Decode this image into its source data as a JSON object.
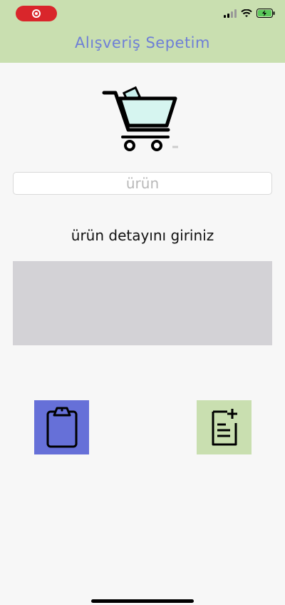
{
  "app": {
    "title": "Alışveriş Sepetim"
  },
  "status_bar": {
    "record_indicator": "record-icon",
    "icons": [
      "signal-icon",
      "wifi-icon",
      "battery-charging-icon"
    ],
    "colors": {
      "record": "#d9262b"
    }
  },
  "form": {
    "product_placeholder": "ürün",
    "detail_label": "ürün detayını giriniz",
    "detail_value": ""
  },
  "actions": {
    "list_button_icon": "clipboard-icon",
    "add_button_icon": "add-document-icon"
  },
  "colors": {
    "header_bg": "#c9dfb0",
    "title": "#6e7fd6",
    "list_button": "#6670d8",
    "add_button": "#c9dfb0",
    "detail_area": "#d3d2d6"
  }
}
